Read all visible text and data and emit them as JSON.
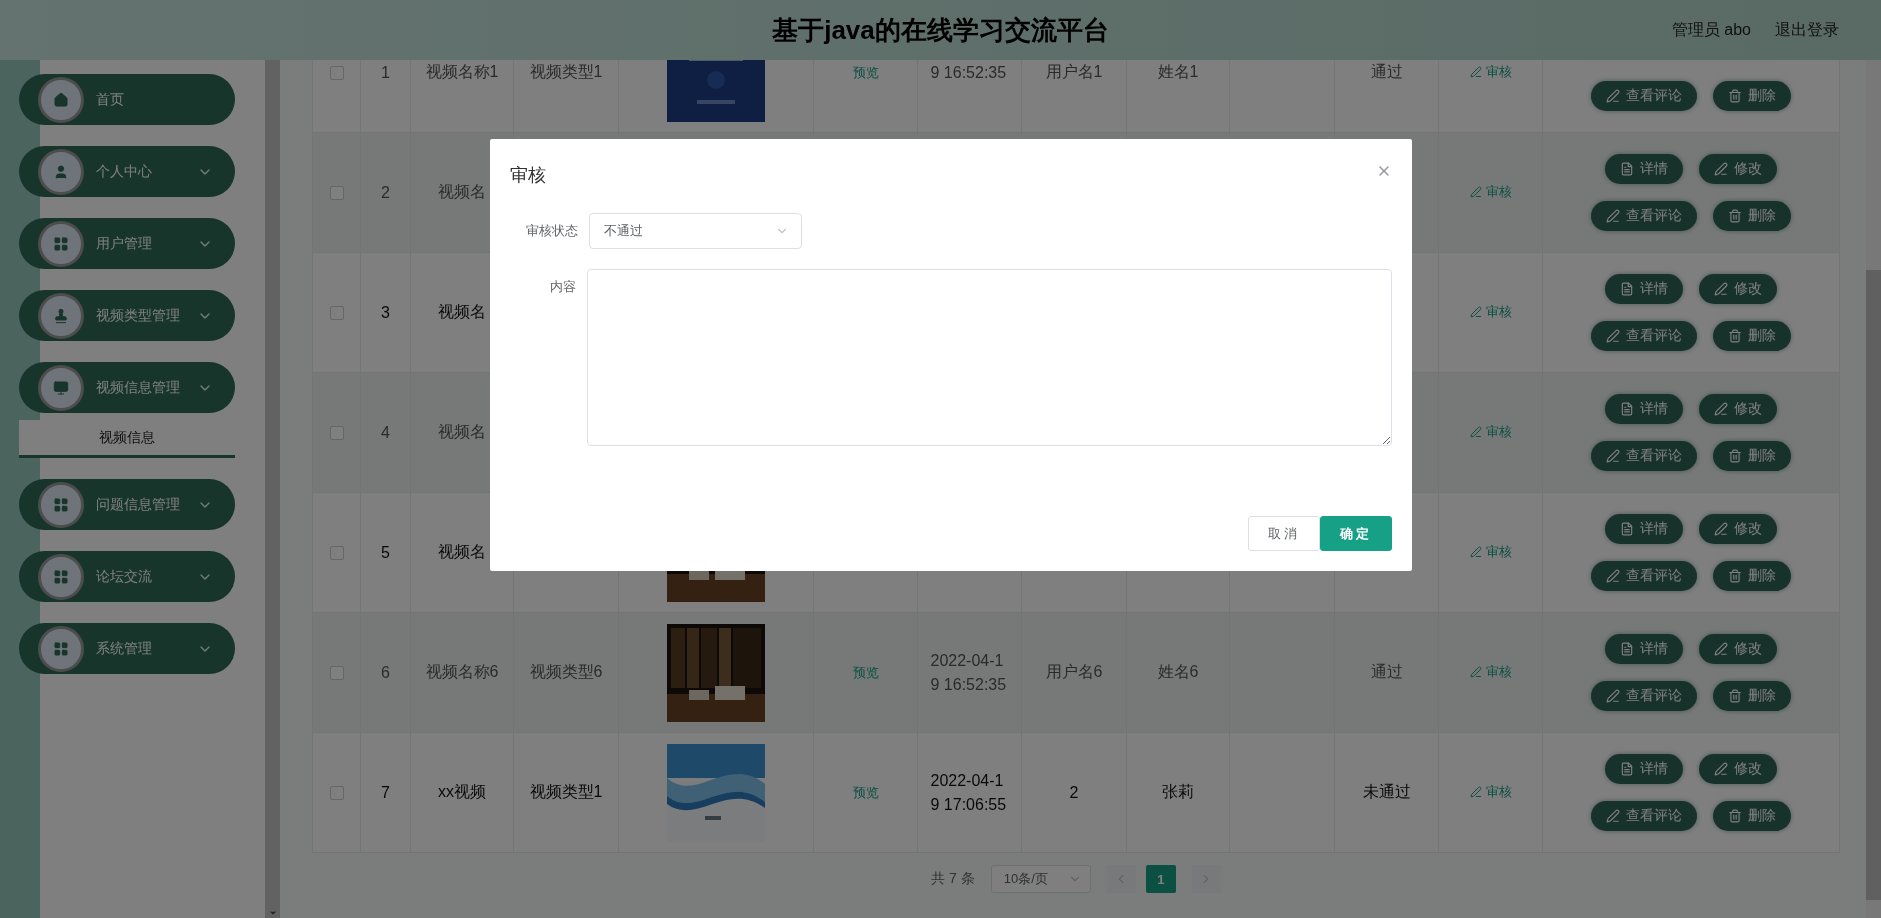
{
  "header": {
    "title": "基于java的在线学习交流平台",
    "user": "管理员 abo",
    "logout": "退出登录"
  },
  "sidebar": {
    "items": [
      {
        "label": "首页",
        "kind": "link"
      },
      {
        "label": "个人中心",
        "kind": "menu"
      },
      {
        "label": "用户管理",
        "kind": "menu"
      },
      {
        "label": "视频类型管理",
        "kind": "menu"
      },
      {
        "label": "视频信息管理",
        "kind": "menu",
        "children": [
          {
            "label": "视频信息",
            "selected": true
          }
        ]
      },
      {
        "label": "问题信息管理",
        "kind": "menu"
      },
      {
        "label": "论坛交流",
        "kind": "menu"
      },
      {
        "label": "系统管理",
        "kind": "menu"
      }
    ]
  },
  "table": {
    "rows": [
      {
        "checked": false,
        "index": "1",
        "name": "视频名称1",
        "type": "视频类型1",
        "preview": "预览",
        "time": "9 16:52:35",
        "username": "用户名1",
        "realname": "姓名1",
        "status": "通过",
        "audit": "审核",
        "actions": {
          "bottom": [
            {
              "kind": "comment",
              "label": "查看评论"
            },
            {
              "kind": "delete",
              "label": "删除"
            }
          ]
        }
      },
      {
        "checked": false,
        "index": "2",
        "name": "视频名",
        "audit": "审核",
        "actions": {
          "top": [
            {
              "kind": "detail",
              "label": "详情"
            },
            {
              "kind": "edit",
              "label": "修改"
            }
          ],
          "bottom": [
            {
              "kind": "comment",
              "label": "查看评论"
            },
            {
              "kind": "delete",
              "label": "删除"
            }
          ]
        }
      },
      {
        "checked": false,
        "index": "3",
        "name": "视频名",
        "audit": "审核",
        "actions": {
          "top": [
            {
              "kind": "detail",
              "label": "详情"
            },
            {
              "kind": "edit",
              "label": "修改"
            }
          ],
          "bottom": [
            {
              "kind": "comment",
              "label": "查看评论"
            },
            {
              "kind": "delete",
              "label": "删除"
            }
          ]
        }
      },
      {
        "checked": false,
        "index": "4",
        "name": "视频名",
        "audit": "审核",
        "actions": {
          "top": [
            {
              "kind": "detail",
              "label": "详情"
            },
            {
              "kind": "edit",
              "label": "修改"
            }
          ],
          "bottom": [
            {
              "kind": "comment",
              "label": "查看评论"
            },
            {
              "kind": "delete",
              "label": "删除"
            }
          ]
        }
      },
      {
        "checked": false,
        "index": "5",
        "name": "视频名",
        "audit": "审核",
        "actions": {
          "top": [
            {
              "kind": "detail",
              "label": "详情"
            },
            {
              "kind": "edit",
              "label": "修改"
            }
          ],
          "bottom": [
            {
              "kind": "comment",
              "label": "查看评论"
            },
            {
              "kind": "delete",
              "label": "删除"
            }
          ]
        }
      },
      {
        "checked": false,
        "index": "6",
        "name": "视频名称6",
        "type": "视频类型6",
        "preview": "预览",
        "time": "2022-04-19 16:52:35",
        "username": "用户名6",
        "realname": "姓名6",
        "status": "通过",
        "audit": "审核",
        "actions": {
          "top": [
            {
              "kind": "detail",
              "label": "详情"
            },
            {
              "kind": "edit",
              "label": "修改"
            }
          ],
          "bottom": [
            {
              "kind": "comment",
              "label": "查看评论"
            },
            {
              "kind": "delete",
              "label": "删除"
            }
          ]
        }
      },
      {
        "checked": false,
        "index": "7",
        "name": "xx视频",
        "type": "视频类型1",
        "preview": "预览",
        "time": "2022-04-19 17:06:55",
        "username": "2",
        "realname": "张莉",
        "status": "未通过",
        "audit": "审核",
        "actions": {
          "top": [
            {
              "kind": "detail",
              "label": "详情"
            },
            {
              "kind": "edit",
              "label": "修改"
            }
          ],
          "bottom": [
            {
              "kind": "comment",
              "label": "查看评论"
            },
            {
              "kind": "delete",
              "label": "删除"
            }
          ]
        }
      }
    ]
  },
  "pagination": {
    "total": "共 7 条",
    "page_size": "10条/页",
    "pages": [
      {
        "label": "1",
        "selected": true
      }
    ]
  },
  "dialog": {
    "title": "审核",
    "fields": [
      {
        "label": "审核状态",
        "kind": "select",
        "value": "不通过"
      },
      {
        "label": "内容",
        "kind": "textarea"
      }
    ],
    "buttons": [
      {
        "label": "取消",
        "kind": "default"
      },
      {
        "label": "确定",
        "kind": "primary"
      }
    ]
  }
}
